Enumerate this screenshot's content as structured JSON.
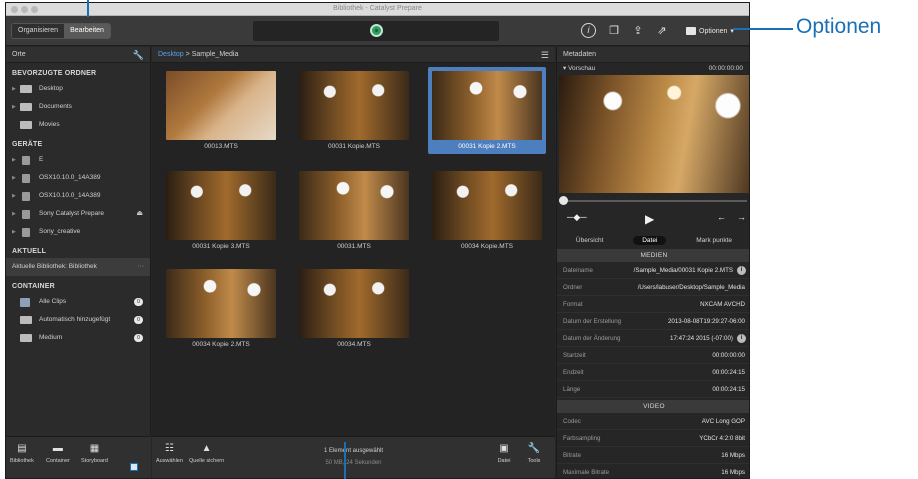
{
  "window": {
    "title": "Bibliothek - Catalyst Prepare"
  },
  "toolbar": {
    "segment": [
      "Organisieren",
      "Bearbeiten"
    ],
    "options_label": "Optionen"
  },
  "sidebar": {
    "header": "Orte",
    "favorites_title": "BEVORZUGTE ORDNER",
    "favorites": [
      "Desktop",
      "Documents",
      "Movies"
    ],
    "devices_title": "GERÄTE",
    "devices": [
      "E",
      "OSX10.10.0_14A389",
      "OSX10.10.0_14A389",
      "Sony Catalyst Prepare",
      "Sony_creative"
    ],
    "current_title": "AKTUELL",
    "current_library": "Aktuelle Bibliothek: Bibliothek",
    "container_title": "CONTAINER",
    "containers": [
      {
        "label": "Alle Clips",
        "count": "0"
      },
      {
        "label": "Automatisch hinzugefügt",
        "count": "0"
      },
      {
        "label": "Medium",
        "count": "0"
      }
    ]
  },
  "browser": {
    "breadcrumb_root": "Desktop",
    "breadcrumb_sep": ">",
    "breadcrumb_leaf": "Sample_Media",
    "clips": [
      "00013.MTS",
      "00031 Kopie.MTS",
      "00031 Kopie 2.MTS",
      "00031 Kopie 3.MTS",
      "00031.MTS",
      "00034 Kopie.MTS",
      "00034 Kopie 2.MTS",
      "00034.MTS"
    ],
    "selected_clip": "00031 Kopie 2.MTS",
    "status_main": "1 Element ausgewählt",
    "status_sub": "50 MB, 24 Sekunden"
  },
  "bottom_left": [
    "Bibliothek",
    "Container",
    "Storyboard"
  ],
  "bottom_center": [
    "Auswählen",
    "Quelle sichern"
  ],
  "bottom_right": [
    "Datei",
    "Tools"
  ],
  "metadata": {
    "header": "Metadaten",
    "preview_label": "Vorschau",
    "timecode": "00:00:00:00",
    "tabs": [
      "Übersicht",
      "Datei",
      "Mark punkte"
    ],
    "active_tab": "Datei",
    "media_group": "MEDIEN",
    "media_rows": [
      {
        "key": "Dateiname",
        "value": "/Sample_Media/00031 Kopie 2.MTS"
      },
      {
        "key": "Ordner",
        "value": "/Users/labuser/Desktop/Sample_Media"
      },
      {
        "key": "Format",
        "value": "NXCAM AVCHD"
      },
      {
        "key": "Datum der Erstellung",
        "value": "2013-08-08T19:29:27-06:00"
      },
      {
        "key": "Datum der Änderung",
        "value": "17:47:24 2015 (-07:00)"
      },
      {
        "key": "Startzeit",
        "value": "00:00:00:00"
      },
      {
        "key": "Endzeit",
        "value": "00:00:24:15"
      },
      {
        "key": "Länge",
        "value": "00:00:24:15"
      }
    ],
    "video_group": "VIDEO",
    "video_rows": [
      {
        "key": "Codec",
        "value": "AVC Long GOP"
      },
      {
        "key": "Farbsampling",
        "value": "YCbCr 4:2:0 8bit"
      },
      {
        "key": "Bitrate",
        "value": "16 Mbps"
      },
      {
        "key": "Maximale Bitrate",
        "value": "16 Mbps"
      }
    ]
  },
  "callout": {
    "label": "Optionen"
  },
  "colors": {
    "accent": "#4d7fbf",
    "callout": "#1a6fb5",
    "chrome": "#262626"
  }
}
